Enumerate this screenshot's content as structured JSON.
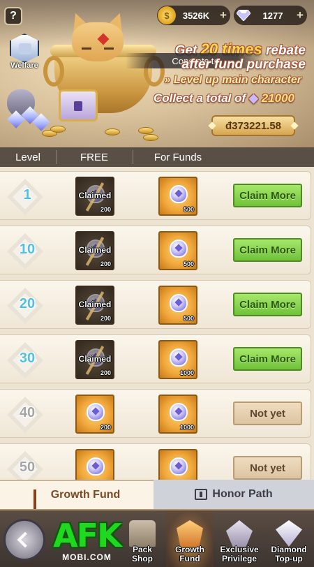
{
  "header": {
    "help_label": "?",
    "currencies": [
      {
        "icon": "gold-coin-icon",
        "value": "3526K",
        "add_label": "+"
      },
      {
        "icon": "diamond-icon",
        "value": "1277",
        "add_label": "+"
      }
    ],
    "welfare_label": "Welfare"
  },
  "banner": {
    "promo_prefix": "Get ",
    "promo_highlight": "20 times",
    "promo_suffix": " rebate",
    "promo_line2": "after fund purchase",
    "promo_line3": "Level up main character",
    "promo_line4_prefix": "Collect a total of ",
    "promo_line4_amount": "21000",
    "toast": "Congrats to",
    "fund_total": "đ373221.58"
  },
  "columns": {
    "level": "Level",
    "free": "FREE",
    "funds": "For Funds"
  },
  "rows": [
    {
      "level": "1",
      "free_amount": "200",
      "free_status": "Claimed",
      "fund_amount": "500",
      "action": "Claim More"
    },
    {
      "level": "10",
      "free_amount": "200",
      "free_status": "Claimed",
      "fund_amount": "500",
      "action": "Claim More"
    },
    {
      "level": "20",
      "free_amount": "200",
      "free_status": "Claimed",
      "fund_amount": "500",
      "action": "Claim More"
    },
    {
      "level": "30",
      "free_amount": "200",
      "free_status": "Claimed",
      "fund_amount": "1000",
      "action": "Claim More"
    },
    {
      "level": "40",
      "free_amount": "200",
      "free_status": "",
      "fund_amount": "1000",
      "action": "Not yet"
    },
    {
      "level": "50",
      "free_amount": "",
      "free_status": "",
      "fund_amount": "",
      "action": "Not yet"
    }
  ],
  "subtabs": {
    "growth_fund": "Growth Fund",
    "honor_path": "Honor Path"
  },
  "watermark": {
    "big": "AFK",
    "small": "MOBI.COM"
  },
  "bottom_nav": {
    "pack_shop": [
      "Pack",
      "Shop"
    ],
    "growth_fund": [
      "Growth",
      "Fund"
    ],
    "exclusive_privilege": [
      "Exclusive",
      "Privilege"
    ],
    "diamond_topup": [
      "Diamond",
      "Top-up"
    ]
  },
  "colors": {
    "accent_green": "#6fc23a",
    "level_blue": "#4ec2e0",
    "header_bar": "#5a4f45"
  }
}
